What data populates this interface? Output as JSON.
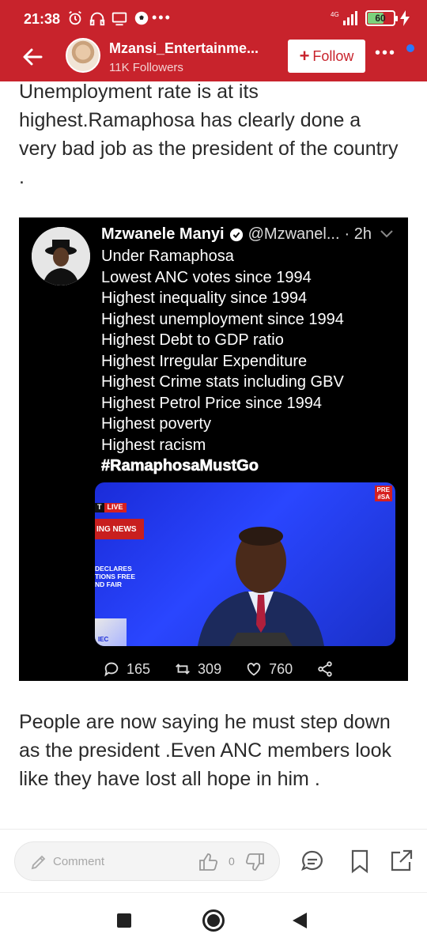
{
  "status_bar": {
    "time": "21:38",
    "network": "4G",
    "battery": "60"
  },
  "header": {
    "profile_name": "Mzansi_Entertainme...",
    "followers": "11K Followers",
    "follow_label": "Follow",
    "follow_plus": "+"
  },
  "article": {
    "paragraph1": "Unemployment rate is at its highest.Ramaphosa has clearly done a very bad job as the president of the country .",
    "paragraph2": "People are now saying he must step down as the president .Even ANC members look like they have lost all hope in him ."
  },
  "tweet": {
    "name": "Mzwanele Manyi",
    "handle": "@Mzwanel...",
    "ago": "· 2h",
    "lines": [
      "Under Ramaphosa",
      "Lowest ANC votes since 1994",
      "Highest inequality since 1994",
      "Highest unemployment since 1994",
      "Highest Debt to GDP ratio",
      "Highest Irregular Expenditure",
      "Highest Crime stats including GBV",
      "Highest Petrol Price since 1994",
      "Highest poverty",
      "Highest racism"
    ],
    "hashtag": "#RamaphosaMustGo",
    "photo": {
      "live_prefix": "T",
      "live": "LIVE",
      "breaking": "ING NEWS",
      "declares": [
        "DECLARES",
        "TIONS FREE",
        "ND FAIR"
      ],
      "iec": "IEC",
      "corner": [
        "PRE",
        "#SA"
      ]
    },
    "replies": "165",
    "retweets": "309",
    "likes": "760"
  },
  "comment_bar": {
    "placeholder": "Comment",
    "like_count": "0"
  },
  "icons": [
    "clock-alarm-icon",
    "headphones-icon",
    "media-icon",
    "soccer-ball-icon",
    "signal-icon",
    "battery-icon",
    "charging-icon",
    "back-arrow-icon",
    "verified-icon",
    "reply-icon",
    "retweet-icon",
    "heart-icon",
    "share-icon",
    "pencil-icon",
    "thumbs-up-icon",
    "thumbs-down-icon",
    "comment-icon",
    "bookmark-icon",
    "share-out-icon"
  ]
}
